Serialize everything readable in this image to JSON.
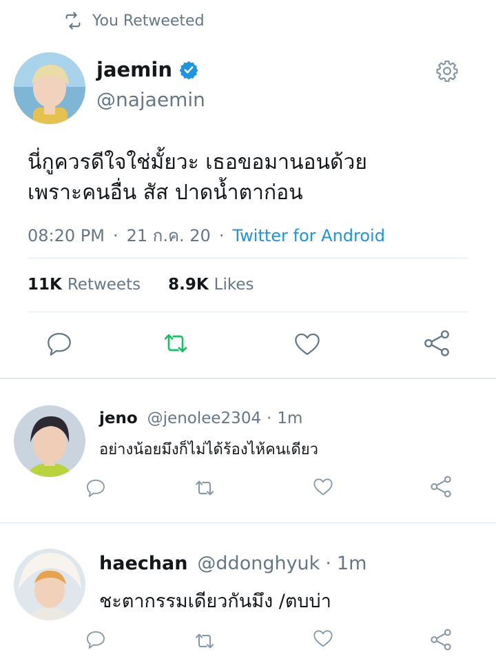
{
  "context": {
    "label": "You Retweeted"
  },
  "tweet": {
    "name": "jaemin",
    "handle": "@najaemin",
    "text_line1": "นี่กูควรดีใจใช่มั้ยวะ เธอขอมานอนด้วย",
    "text_line2": "เพราะคนอื่น สัส ปาดน้ำตาก่อน",
    "time": "08:20 PM",
    "date": "21 ก.ค. 20",
    "source": "Twitter for Android",
    "retweets_count": "11K",
    "retweets_label": "Retweets",
    "likes_count": "8.9K",
    "likes_label": "Likes"
  },
  "replies": [
    {
      "name": "jeno",
      "handle": "@jenolee2304",
      "time": "1m",
      "text": "อย่างน้อยมึงก็ไม่ได้ร้องไห้คนเดียว"
    },
    {
      "name": "haechan",
      "handle": "@ddonghyuk",
      "time": "1m",
      "text": "ชะตากรรมเดียวกันมึง /ตบบ่า"
    }
  ],
  "separator": "·",
  "colors": {
    "accent": "#1b95e0",
    "muted": "#657786",
    "retweet_active": "#17bf63",
    "divider": "#e1e8ed"
  },
  "icons": [
    "retweet-icon",
    "verified-badge-icon",
    "gear-icon",
    "reply-icon",
    "like-icon",
    "share-icon"
  ]
}
